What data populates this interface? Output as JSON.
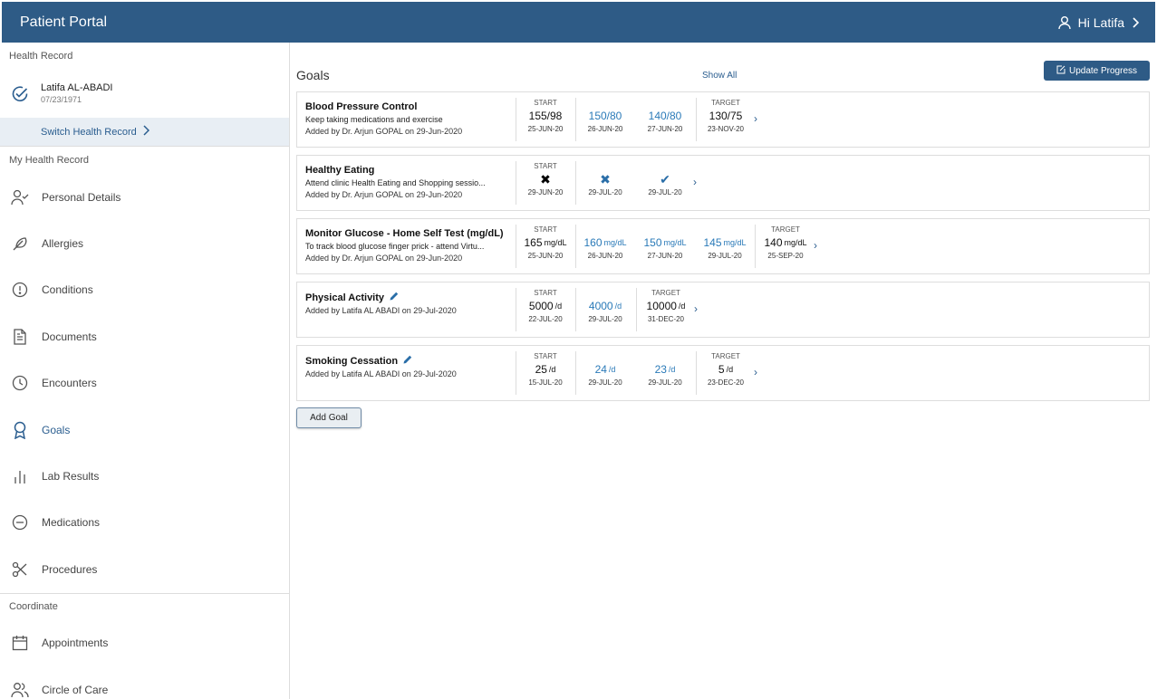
{
  "app": {
    "title": "Patient Portal",
    "greeting": "Hi Latifa"
  },
  "sidebar": {
    "health_record_label": "Health Record",
    "record": {
      "name": "Latifa AL-ABADI",
      "dob": "07/23/1971",
      "switch_label": "Switch Health Record"
    },
    "my_health_record_label": "My Health Record",
    "items": [
      {
        "label": "Personal Details",
        "icon": "person-check-icon"
      },
      {
        "label": "Allergies",
        "icon": "feather-icon"
      },
      {
        "label": "Conditions",
        "icon": "alert-circle-icon"
      },
      {
        "label": "Documents",
        "icon": "document-icon"
      },
      {
        "label": "Encounters",
        "icon": "clock-icon"
      },
      {
        "label": "Goals",
        "icon": "award-icon",
        "active": true
      },
      {
        "label": "Lab Results",
        "icon": "bar-chart-icon"
      },
      {
        "label": "Medications",
        "icon": "minus-circle-icon"
      },
      {
        "label": "Procedures",
        "icon": "scissors-icon"
      }
    ],
    "coordinate_label": "Coordinate",
    "coordinate_items": [
      {
        "label": "Appointments",
        "icon": "calendar-icon"
      },
      {
        "label": "Circle of Care",
        "icon": "people-icon"
      }
    ]
  },
  "goals": {
    "title": "Goals",
    "show_all": "Show All",
    "update_progress": "Update Progress",
    "add_goal": "Add Goal",
    "start_label": "START",
    "target_label": "TARGET",
    "items": [
      {
        "title": "Blood Pressure Control",
        "description": "Keep taking medications and exercise",
        "added": "Added by Dr. Arjun GOPAL on 29-Jun-2020",
        "start": {
          "value": "155/98",
          "unit": "",
          "date": "25-JUN-20"
        },
        "progress": [
          {
            "value": "150/80",
            "unit": "",
            "date": "26-JUN-20"
          },
          {
            "value": "140/80",
            "unit": "",
            "date": "27-JUN-20"
          }
        ],
        "target": {
          "value": "130/75",
          "unit": "",
          "date": "23-NOV-20"
        }
      },
      {
        "title": "Healthy Eating",
        "description": "Attend clinic Health Eating and Shopping sessio...",
        "added": "Added by Dr. Arjun GOPAL on 29-Jun-2020",
        "start": {
          "value": "✖",
          "unit": "",
          "date": "29-JUN-20"
        },
        "progress": [
          {
            "value": "✖",
            "unit": "",
            "date": "29-JUL-20"
          },
          {
            "value": "✔",
            "unit": "",
            "date": "29-JUL-20"
          }
        ]
      },
      {
        "title": "Monitor Glucose - Home Self Test (mg/dL)",
        "description": "To track blood glucose finger prick - attend Virtu...",
        "added": "Added by Dr. Arjun GOPAL on 29-Jun-2020",
        "start": {
          "value": "165",
          "unit": "mg/dL",
          "date": "25-JUN-20"
        },
        "progress": [
          {
            "value": "160",
            "unit": "mg/dL",
            "date": "26-JUN-20"
          },
          {
            "value": "150",
            "unit": "mg/dL",
            "date": "27-JUN-20"
          },
          {
            "value": "145",
            "unit": "mg/dL",
            "date": "29-JUL-20"
          }
        ],
        "target": {
          "value": "140",
          "unit": "mg/dL",
          "date": "25-SEP-20"
        }
      },
      {
        "title": "Physical Activity",
        "description": "",
        "added": "Added by Latifa AL ABADI on 29-Jul-2020",
        "start": {
          "value": "5000",
          "unit": "/d",
          "date": "22-JUL-20"
        },
        "progress": [
          {
            "value": "4000",
            "unit": "/d",
            "date": "29-JUL-20"
          }
        ],
        "target": {
          "value": "10000",
          "unit": "/d",
          "date": "31-DEC-20"
        }
      },
      {
        "title": "Smoking Cessation",
        "description": "",
        "added": "Added by Latifa AL ABADI on 29-Jul-2020",
        "start": {
          "value": "25",
          "unit": "/d",
          "date": "15-JUL-20"
        },
        "progress": [
          {
            "value": "24",
            "unit": "/d",
            "date": "29-JUL-20"
          },
          {
            "value": "23",
            "unit": "/d",
            "date": "29-JUL-20"
          }
        ],
        "target": {
          "value": "5",
          "unit": "/d",
          "date": "23-DEC-20"
        }
      }
    ]
  }
}
